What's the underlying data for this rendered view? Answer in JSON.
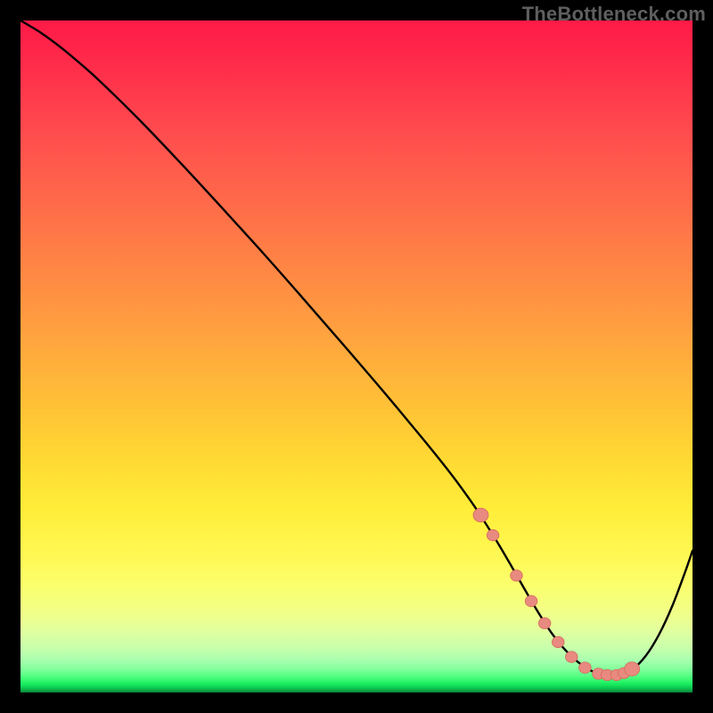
{
  "watermark": "TheBottleneck.com",
  "colors": {
    "curve": "#000000",
    "marker_fill": "#e88a7f",
    "marker_stroke": "#d66b5e"
  },
  "chart_data": {
    "type": "line",
    "title": "",
    "xlabel": "",
    "ylabel": "",
    "xlim": [
      0,
      100
    ],
    "ylim": [
      0,
      100
    ],
    "series": [
      {
        "name": "curve",
        "x": [
          0,
          3,
          6,
          9,
          12,
          18,
          24,
          30,
          36,
          42,
          48,
          54,
          60,
          64,
          67,
          69,
          71,
          73,
          75,
          77,
          79,
          81,
          83,
          85,
          87,
          89,
          91,
          93,
          95,
          97,
          99,
          100
        ],
        "y": [
          100,
          98.2,
          96.0,
          93.5,
          90.8,
          84.9,
          78.6,
          72.1,
          65.5,
          58.7,
          51.8,
          44.8,
          37.6,
          32.6,
          28.5,
          25.5,
          22.3,
          18.9,
          15.4,
          12.0,
          8.9,
          6.4,
          4.5,
          3.2,
          2.6,
          2.6,
          3.4,
          5.4,
          8.6,
          12.9,
          18.2,
          21.1
        ]
      }
    ],
    "markers": {
      "name": "highlight-region",
      "x": [
        68.5,
        70.3,
        73.8,
        76.0,
        78.0,
        80.0,
        82.0,
        84.0,
        86.0,
        87.3,
        88.7,
        89.8,
        91.0
      ],
      "y": [
        26.4,
        23.4,
        17.4,
        13.6,
        10.3,
        7.5,
        5.3,
        3.7,
        2.8,
        2.6,
        2.6,
        2.9,
        3.5
      ]
    }
  }
}
